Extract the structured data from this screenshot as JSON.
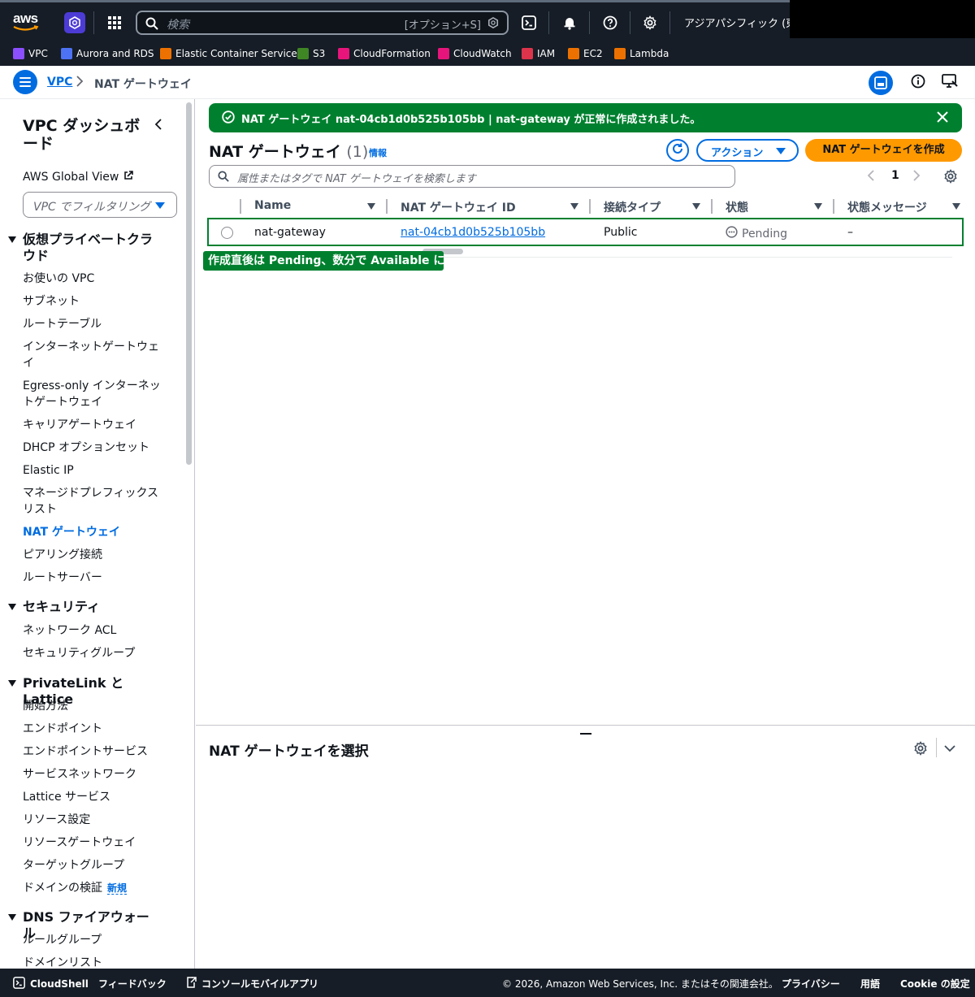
{
  "topnav": {
    "logo_text": "aws",
    "search_placeholder": "検索",
    "search_shortcut": "[オプション+S]",
    "region": "アジアパシフィック (東京)",
    "favorites": [
      {
        "label": "VPC",
        "color": "#8c4fff"
      },
      {
        "label": "Aurora and RDS",
        "color": "#4d72f3"
      },
      {
        "label": "Elastic Container Service",
        "color": "#ed7100"
      },
      {
        "label": "S3",
        "color": "#3f8624"
      },
      {
        "label": "CloudFormation",
        "color": "#e7157b"
      },
      {
        "label": "CloudWatch",
        "color": "#e7157b"
      },
      {
        "label": "IAM",
        "color": "#dd344c"
      },
      {
        "label": "EC2",
        "color": "#ed7100"
      },
      {
        "label": "Lambda",
        "color": "#ed7100"
      }
    ]
  },
  "breadcrumb": {
    "root": "VPC",
    "current": "NAT ゲートウェイ"
  },
  "sidebar": {
    "title": "VPC ダッシュボード",
    "global_view": "AWS Global View",
    "filter_placeholder": "VPC でフィルタリング",
    "sections": {
      "vpc": "仮想プライベートクラウド",
      "security": "セキュリティ",
      "privatelink": "PrivateLink と Lattice",
      "dns_firewall": "DNS ファイアウォール"
    },
    "vpc_items": [
      "お使いの VPC",
      "サブネット",
      "ルートテーブル",
      "インターネットゲートウェイ",
      "Egress-only インターネットゲートウェイ",
      "キャリアゲートウェイ",
      "DHCP オプションセット",
      "Elastic IP",
      "マネージドプレフィックスリスト",
      "NAT ゲートウェイ",
      "ピアリング接続",
      "ルートサーバー"
    ],
    "security_items": [
      "ネットワーク ACL",
      "セキュリティグループ"
    ],
    "privatelink_items": [
      "開始方法",
      "エンドポイント",
      "エンドポイントサービス",
      "サービスネットワーク",
      "Lattice サービス",
      "リソース設定",
      "リソースゲートウェイ",
      "ターゲットグループ",
      "ドメインの検証"
    ],
    "new_badge": "新規",
    "dns_items": [
      "ルールグループ",
      "ドメインリスト"
    ]
  },
  "flash": {
    "message": "NAT ゲートウェイ nat-04cb1d0b525b105bb | nat-gateway が正常に作成されました。"
  },
  "page": {
    "title": "NAT ゲートウェイ",
    "count": "(1)",
    "info": "情報",
    "actions_label": "アクション",
    "create_label": "NAT ゲートウェイを作成",
    "search_placeholder": "属性またはタグで NAT ゲートウェイを検索します",
    "page_number": "1"
  },
  "table": {
    "headers": [
      "Name",
      "NAT ゲートウェイ ID",
      "接続タイプ",
      "状態",
      "状態メッセージ"
    ],
    "rows": [
      {
        "name": "nat-gateway",
        "id": "nat-04cb1d0b525b105bb",
        "type": "Public",
        "status": "Pending",
        "status_message": "–"
      }
    ]
  },
  "annotation": "作成直後は Pending、数分で Available に",
  "detail_panel": {
    "title": "NAT ゲートウェイを選択"
  },
  "footer": {
    "cloudshell": "CloudShell",
    "feedback": "フィードバック",
    "mobile_app": "コンソールモバイルアプリ",
    "copyright": "© 2026, Amazon Web Services, Inc. またはその関連会社。",
    "privacy": "プライバシー",
    "terms": "用語",
    "cookie": "Cookie の設定"
  }
}
